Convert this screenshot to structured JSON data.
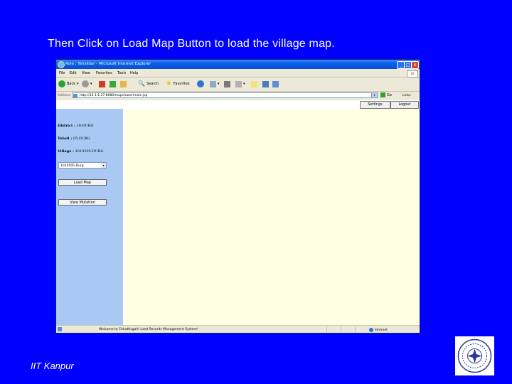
{
  "slide": {
    "title": "Then Click on Load Map Button to load the village map.",
    "footer": "IIT Kanpur"
  },
  "browser": {
    "window_title": "Role : Tehsildar - Microsoft Internet Explorer",
    "menu": [
      "File",
      "Edit",
      "View",
      "Favorites",
      "Tools",
      "Help"
    ],
    "toolbar": {
      "back_label": "Back",
      "search_label": "Search",
      "favorites_label": "Favorites"
    },
    "address": {
      "label": "Address",
      "url": "http://10.1.1.27:8080/mapviewer/main.jsp",
      "go_label": "Go",
      "links_label": "Links"
    },
    "status": {
      "text": "Welcome to Chhattisgarh Land Records Management System!",
      "zone": "Internet"
    }
  },
  "app": {
    "settings_label": "Settings",
    "logout_label": "Logout",
    "district_label": "District :",
    "district_value": "10-DURG",
    "tehsil_label": "Tehsil :",
    "tehsil_value": "05-DURG",
    "village_label": "Village :",
    "village_value": "1010505-DURG",
    "village_select_value": "1010505-Durg",
    "load_map_label": "Load Map",
    "view_mutation_label": "View Mutation"
  },
  "colors": {
    "slide_background": "#0000ff",
    "left_panel": "#a9c9f4",
    "map_panel": "#ffffe1",
    "titlebar": "#0a5ee8"
  }
}
